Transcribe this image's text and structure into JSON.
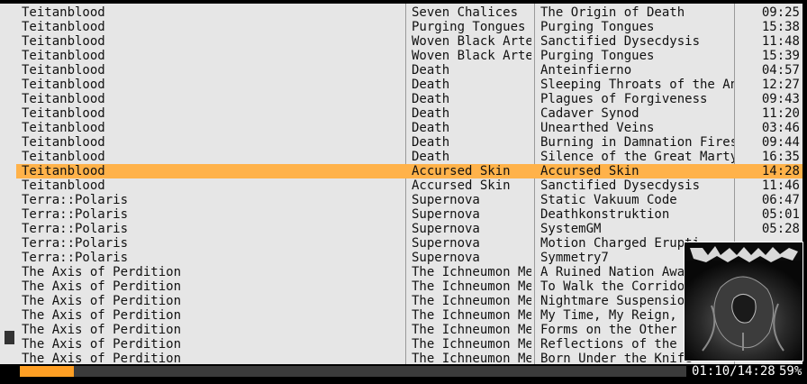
{
  "tracks": [
    {
      "artist": "Teitanblood",
      "album": "Seven Chalices",
      "title": "The Origin of Death",
      "time": "09:25"
    },
    {
      "artist": "Teitanblood",
      "album": "Purging Tongues",
      "title": "Purging Tongues",
      "time": "15:38"
    },
    {
      "artist": "Teitanblood",
      "album": "Woven Black Arter",
      "title": "Sanctified Dysecdysis",
      "time": "11:48"
    },
    {
      "artist": "Teitanblood",
      "album": "Woven Black Arter",
      "title": "Purging Tongues",
      "time": "15:39"
    },
    {
      "artist": "Teitanblood",
      "album": "Death",
      "title": "Anteinfierno",
      "time": "04:57"
    },
    {
      "artist": "Teitanblood",
      "album": "Death",
      "title": "Sleeping Throats of the Ant",
      "time": "12:27"
    },
    {
      "artist": "Teitanblood",
      "album": "Death",
      "title": "Plagues of Forgiveness",
      "time": "09:43"
    },
    {
      "artist": "Teitanblood",
      "album": "Death",
      "title": "Cadaver Synod",
      "time": "11:20"
    },
    {
      "artist": "Teitanblood",
      "album": "Death",
      "title": "Unearthed Veins",
      "time": "03:46"
    },
    {
      "artist": "Teitanblood",
      "album": "Death",
      "title": "Burning in Damnation Fires",
      "time": "09:44"
    },
    {
      "artist": "Teitanblood",
      "album": "Death",
      "title": "Silence of the Great Martyr",
      "time": "16:35"
    },
    {
      "artist": "Teitanblood",
      "album": "Accursed Skin",
      "title": "Accursed Skin",
      "time": "14:28",
      "selected": true
    },
    {
      "artist": "Teitanblood",
      "album": "Accursed Skin",
      "title": "Sanctified Dysecdysis",
      "time": "11:46"
    },
    {
      "artist": "Terra::Polaris",
      "album": "Supernova",
      "title": "Static Vakuum Code",
      "time": "06:47"
    },
    {
      "artist": "Terra::Polaris",
      "album": "Supernova",
      "title": "Deathkonstruktion",
      "time": "05:01"
    },
    {
      "artist": "Terra::Polaris",
      "album": "Supernova",
      "title": "SystemGM",
      "time": "05:28"
    },
    {
      "artist": "Terra::Polaris",
      "album": "Supernova",
      "title": "Motion Charged Erupti",
      "time": ""
    },
    {
      "artist": "Terra::Polaris",
      "album": "Supernova",
      "title": "Symmetry7",
      "time": ""
    },
    {
      "artist": "The Axis of Perdition",
      "album": "The Ichneumon Met",
      "title": "A Ruined Nation Awak",
      "time": ""
    },
    {
      "artist": "The Axis of Perdition",
      "album": "The Ichneumon Met",
      "title": "To Walk the Corridor",
      "time": ""
    },
    {
      "artist": "The Axis of Perdition",
      "album": "The Ichneumon Met",
      "title": "Nightmare Suspension",
      "time": ""
    },
    {
      "artist": "The Axis of Perdition",
      "album": "The Ichneumon Met",
      "title": "My Time, My Reign, M",
      "time": ""
    },
    {
      "artist": "The Axis of Perdition",
      "album": "The Ichneumon Met",
      "title": "Forms on the Other S",
      "time": ""
    },
    {
      "artist": "The Axis of Perdition",
      "album": "The Ichneumon Met",
      "title": "Reflections of the U",
      "time": ""
    },
    {
      "artist": "The Axis of Perdition",
      "album": "The Ichneumon Met",
      "title": "Born Under the Knife",
      "time": ""
    }
  ],
  "status": {
    "time": "01:10/14:28",
    "volume": "59%",
    "progress_fraction": 0.081
  },
  "colors": {
    "background": "#e6e6e6",
    "selection": "#ffb24a",
    "progress": "#ff9f24"
  },
  "cover_art": {
    "icon": "album-cover-art"
  }
}
